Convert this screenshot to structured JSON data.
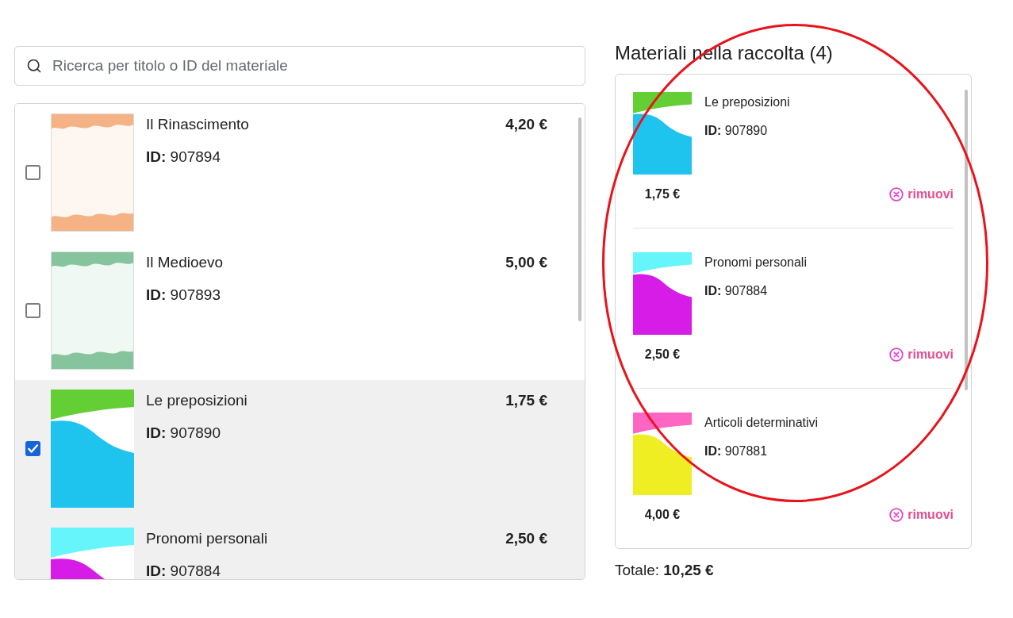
{
  "search": {
    "placeholder": "Ricerca per titolo o ID del materiale"
  },
  "materials": [
    {
      "title": "Il Rinascimento",
      "id": "**ID:** 907894",
      "price": "4,20 €",
      "selected": false,
      "checked": false,
      "cover": {
        "kind": "watercolor",
        "bands": [
          {
            "color": "#f5b385"
          }
        ]
      }
    },
    {
      "title": "Il Medioevo",
      "id": "**ID:** 907893",
      "price": "5,00 €",
      "selected": false,
      "checked": false,
      "cover": {
        "kind": "watercolor",
        "bands": [
          {
            "color": "#86c49e"
          }
        ]
      }
    },
    {
      "title": "Le preposizioni",
      "id": "**ID:** 907890",
      "price": "1,75 €",
      "selected": true,
      "checked": true,
      "cover": {
        "kind": "wave",
        "bands": [
          {
            "color": "#63cf34"
          },
          {
            "color": "#1ec4ee"
          }
        ]
      }
    },
    {
      "title": "Pronomi personali",
      "id": "**ID:** 907884",
      "price": "2,50 €",
      "selected": true,
      "cover": {
        "kind": "wave",
        "bands": [
          {
            "color": "#66f5fa"
          },
          {
            "color": "#d81ce8"
          }
        ]
      }
    }
  ],
  "collection": {
    "title": "Materiali nella raccolta (4)",
    "items": [
      {
        "title": "Le preposizioni",
        "id": "**ID:** 907890",
        "price": "1,75 €",
        "remove": "rimuovi",
        "cover": {
          "kind": "wave",
          "bands": [
            {
              "color": "#63cf34"
            },
            {
              "color": "#1ec4ee"
            }
          ]
        }
      },
      {
        "title": "Pronomi personali",
        "id": "**ID:** 907884",
        "price": "2,50 €",
        "remove": "rimuovi",
        "cover": {
          "kind": "wave",
          "bands": [
            {
              "color": "#66f5fa"
            },
            {
              "color": "#d81ce8"
            }
          ]
        }
      },
      {
        "title": "Articoli determinativi",
        "id": "**ID:** 907881",
        "price": "4,00 €",
        "remove": "rimuovi",
        "cover": {
          "kind": "wave",
          "bands": [
            {
              "color": "#ff66c4"
            },
            {
              "color": "#eeee22"
            }
          ]
        }
      }
    ],
    "total": "Totale: **10,25 €**"
  },
  "annotation": {
    "kind": "ellipse"
  }
}
